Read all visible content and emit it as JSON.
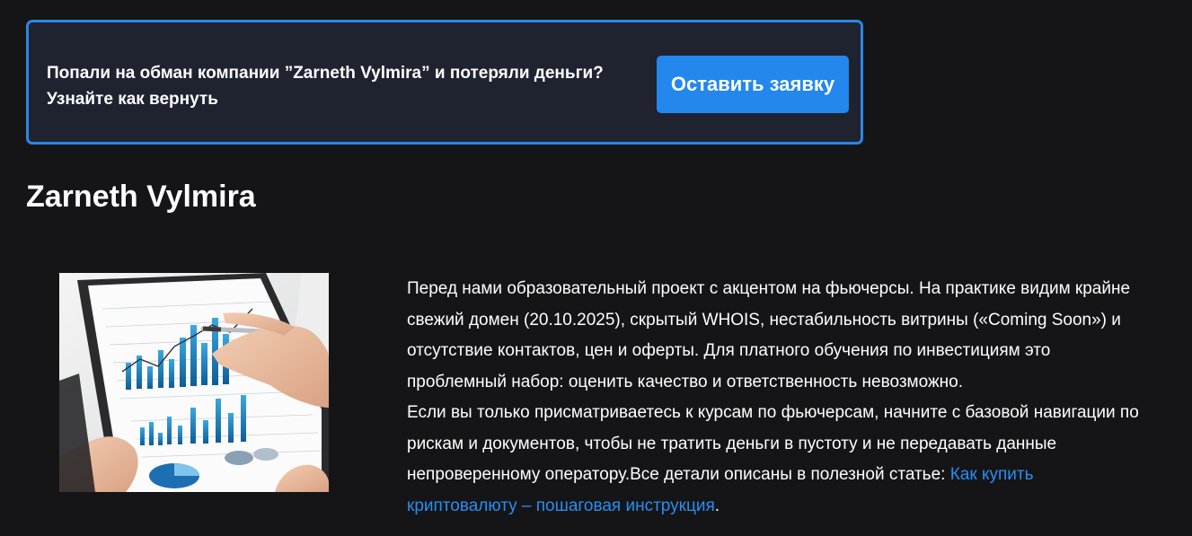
{
  "banner": {
    "line1": "Попали на обман компании ”Zarneth Vylmira” и потеряли деньги?",
    "line2": "Узнайте как вернуть",
    "button_label": "Оставить заявку"
  },
  "page": {
    "title": "Zarneth Vylmira"
  },
  "article": {
    "paragraph1": [
      "Перед нами образовательный проект с акцентом на фьючерсы. На практике видим крайне",
      "свежий домен (20.10.2025), скрытый WHOIS, нестабильность витрины («Coming Soon») и",
      "отсутствие контактов, цен и оферты. Для платного обучения по инвестициям это",
      "проблемный набор: оценить качество и ответственность невозможно."
    ],
    "paragraph2": [
      "Если вы только присматриваетесь к курсам по фьючерсам, начните с базовой навигации по",
      "рискам и документов, чтобы не тратить деньги в пустоту и не передавать данные"
    ],
    "paragraph2_line3_text": "непроверенному оператору.Все детали описаны в полезной статье: ",
    "link_part1": "Как купить",
    "link_part2": "криптовалюту – пошаговая инструкция",
    "trailing_period": "."
  },
  "colors": {
    "background": "#151517",
    "banner_bg": "#1f2330",
    "banner_border": "#2b86e6",
    "button": "#2387ee",
    "link": "#2a8ef0"
  },
  "icons": {
    "photo": "business-chart-photo"
  }
}
